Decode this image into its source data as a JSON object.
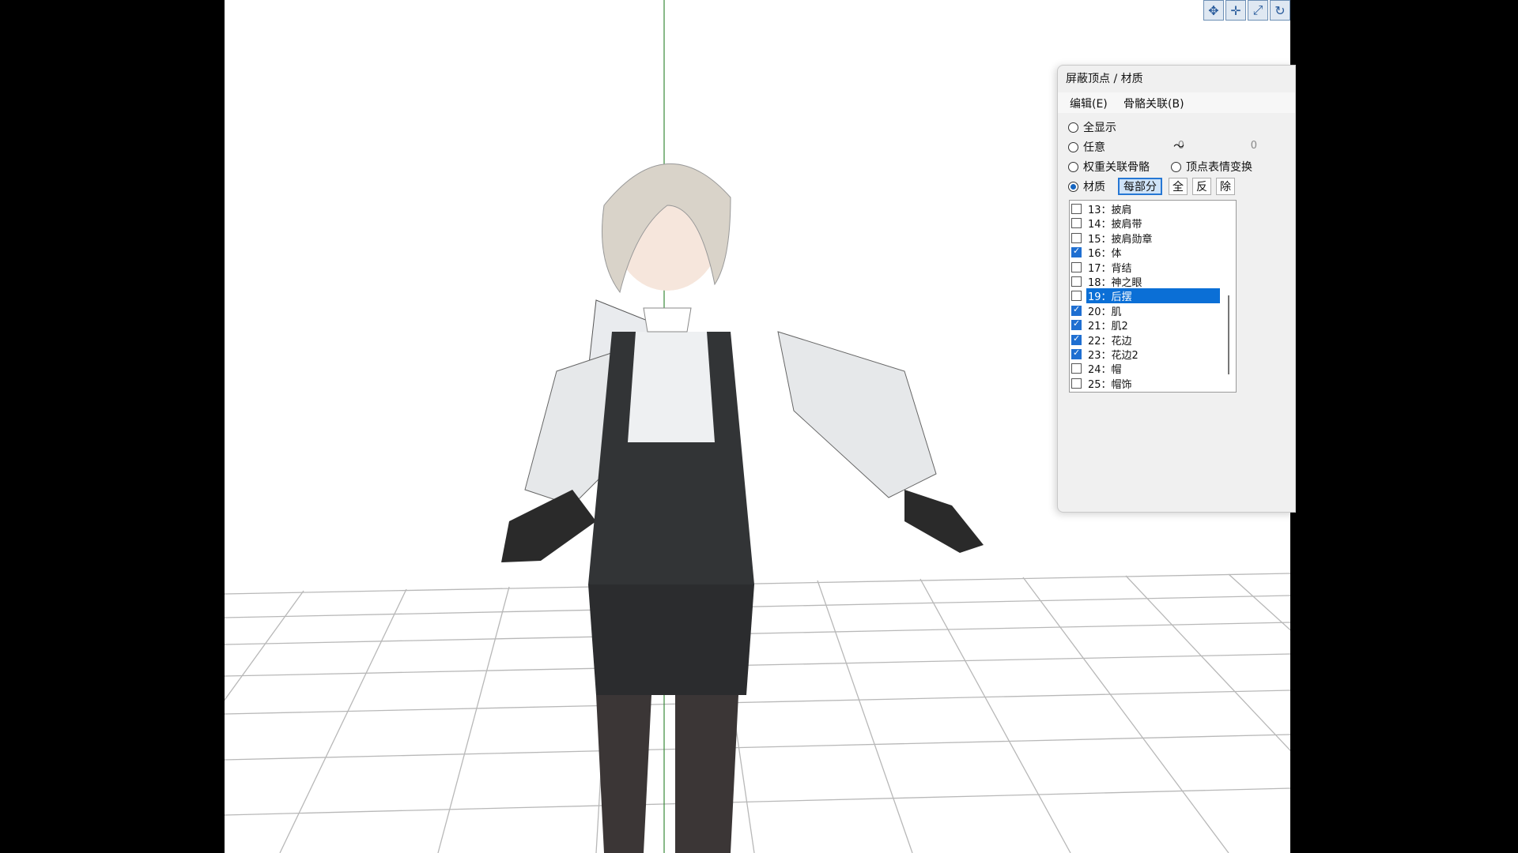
{
  "viewport": {
    "background": "#ffffff"
  },
  "toolbar": {
    "icons": [
      "move-icon",
      "translate-icon",
      "rotate-axis-icon",
      "rotate-icon"
    ]
  },
  "dialog": {
    "title": "屏蔽顶点 / 材质",
    "menu": {
      "edit": "编辑(E)",
      "bone": "骨骼关联(B)"
    },
    "options": {
      "show_all": "全显示",
      "arbitrary": "任意",
      "range_from": "0",
      "range_sep": "～",
      "range_to": "0",
      "weight_bone": "权重关联骨骼",
      "vertex_morph": "顶点表情变换",
      "material": "材质",
      "selected": "material"
    },
    "buttons": {
      "per_part": "每部分",
      "all": "全",
      "invert": "反",
      "remove": "除"
    },
    "materials": [
      {
        "label": "13：披肩",
        "checked": false,
        "selected": false
      },
      {
        "label": "14：披肩带",
        "checked": false,
        "selected": false
      },
      {
        "label": "15：披肩勋章",
        "checked": false,
        "selected": false
      },
      {
        "label": "16：体",
        "checked": true,
        "selected": false
      },
      {
        "label": "17：背结",
        "checked": false,
        "selected": false
      },
      {
        "label": "18：神之眼",
        "checked": false,
        "selected": false
      },
      {
        "label": "19：后摆",
        "checked": false,
        "selected": true
      },
      {
        "label": "20：肌",
        "checked": true,
        "selected": false
      },
      {
        "label": "21：肌2",
        "checked": true,
        "selected": false
      },
      {
        "label": "22：花边",
        "checked": true,
        "selected": false
      },
      {
        "label": "23：花边2",
        "checked": true,
        "selected": false
      },
      {
        "label": "24：帽",
        "checked": false,
        "selected": false
      },
      {
        "label": "25：帽饰",
        "checked": false,
        "selected": false
      }
    ]
  }
}
